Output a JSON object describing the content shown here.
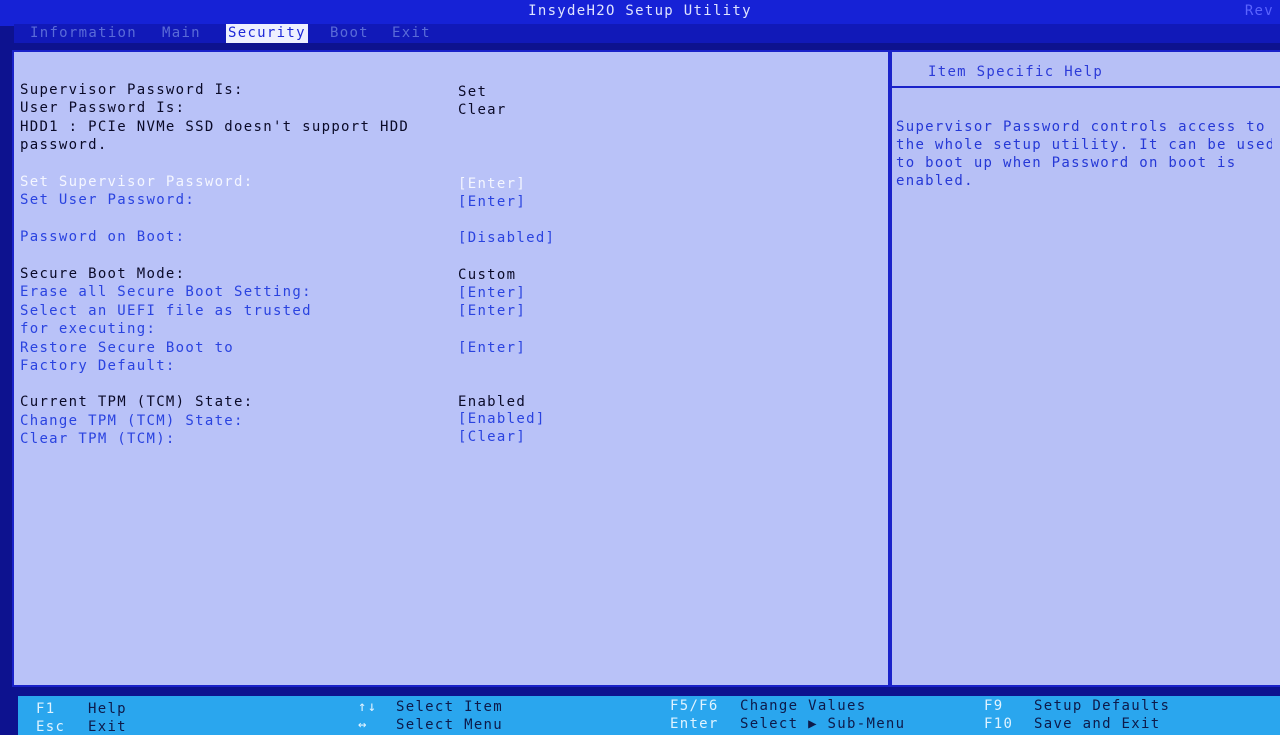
{
  "title": "InsydeH2O Setup Utility",
  "title_corner": "Rev",
  "menu": [
    {
      "label": "Information",
      "active": false
    },
    {
      "label": "Main",
      "active": false
    },
    {
      "label": "Security",
      "active": true
    },
    {
      "label": "Boot",
      "active": false
    },
    {
      "label": "Exit",
      "active": false
    }
  ],
  "security": {
    "supervisor_pw_label": "Supervisor Password Is:",
    "supervisor_pw_value": "Set",
    "user_pw_label": "User Password Is:",
    "user_pw_value": "Clear",
    "hdd_note_line1": "HDD1 : PCIe NVMe SSD doesn't support HDD",
    "hdd_note_line2": "password.",
    "set_supervisor_label": "Set Supervisor Password:",
    "set_supervisor_value": "[Enter]",
    "set_user_label": "Set User Password:",
    "set_user_value": "[Enter]",
    "pw_on_boot_label": "Password on Boot:",
    "pw_on_boot_value": "[Disabled]",
    "secure_boot_mode_label": "Secure Boot Mode:",
    "secure_boot_mode_value": "Custom",
    "erase_label": "Erase all Secure Boot Setting:",
    "erase_value": "[Enter]",
    "select_uefi_line1": "Select an UEFI file as trusted",
    "select_uefi_line2": "for executing:",
    "select_uefi_value": "[Enter]",
    "restore_line1": "Restore Secure Boot to",
    "restore_line2": "Factory Default:",
    "restore_value": "[Enter]",
    "tpm_state_label": "Current TPM (TCM) State:",
    "tpm_state_value": "Enabled",
    "change_tpm_label": "Change TPM (TCM) State:",
    "change_tpm_value": "[Enabled]",
    "clear_tpm_label": "Clear TPM (TCM):",
    "clear_tpm_value": "[Clear]"
  },
  "help": {
    "title": "Item Specific Help",
    "text": "Supervisor Password controls access to\nthe whole setup utility. It can be used\nto boot up when Password on boot is\nenabled."
  },
  "keys": {
    "f1": "F1",
    "f1_desc": "Help",
    "esc": "Esc",
    "esc_desc": "Exit",
    "updown": "↑↓",
    "updown_desc": "Select Item",
    "leftright": "↔",
    "leftright_desc": "Select Menu",
    "f5f6": "F5/F6",
    "f5f6_desc": "Change Values",
    "enter": "Enter",
    "enter_desc": "Select ▶ Sub-Menu",
    "f9": "F9",
    "f9_desc": "Setup Defaults",
    "f10": "F10",
    "f10_desc": "Save and Exit"
  }
}
